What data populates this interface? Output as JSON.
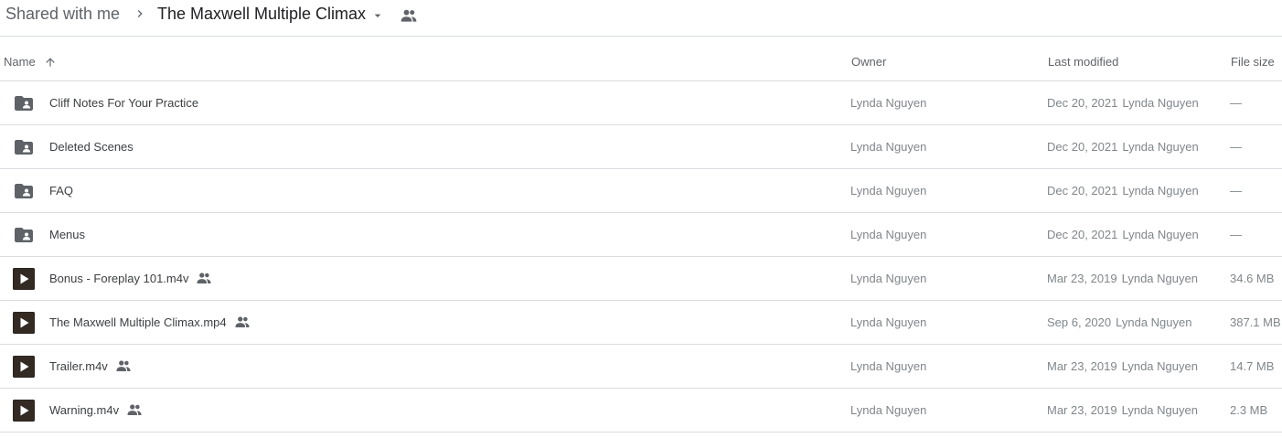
{
  "breadcrumb": {
    "root": "Shared with me",
    "current": "The Maxwell Multiple Climax"
  },
  "columns": {
    "name": "Name",
    "owner": "Owner",
    "last_modified": "Last modified",
    "file_size": "File size"
  },
  "files": [
    {
      "name": "Cliff Notes For Your Practice",
      "type": "shared-folder",
      "owner": "Lynda Nguyen",
      "modified_date": "Dec 20, 2021",
      "modified_by": "Lynda Nguyen",
      "size": "—",
      "shared": false
    },
    {
      "name": "Deleted Scenes",
      "type": "shared-folder",
      "owner": "Lynda Nguyen",
      "modified_date": "Dec 20, 2021",
      "modified_by": "Lynda Nguyen",
      "size": "—",
      "shared": false
    },
    {
      "name": "FAQ",
      "type": "shared-folder",
      "owner": "Lynda Nguyen",
      "modified_date": "Dec 20, 2021",
      "modified_by": "Lynda Nguyen",
      "size": "—",
      "shared": false
    },
    {
      "name": "Menus",
      "type": "shared-folder",
      "owner": "Lynda Nguyen",
      "modified_date": "Dec 20, 2021",
      "modified_by": "Lynda Nguyen",
      "size": "—",
      "shared": false
    },
    {
      "name": "Bonus - Foreplay 101.m4v",
      "type": "video",
      "owner": "Lynda Nguyen",
      "modified_date": "Mar 23, 2019",
      "modified_by": "Lynda Nguyen",
      "size": "34.6 MB",
      "shared": true
    },
    {
      "name": "The Maxwell Multiple Climax.mp4",
      "type": "video",
      "owner": "Lynda Nguyen",
      "modified_date": "Sep 6, 2020",
      "modified_by": "Lynda Nguyen",
      "size": "387.1 MB",
      "shared": true
    },
    {
      "name": "Trailer.m4v",
      "type": "video",
      "owner": "Lynda Nguyen",
      "modified_date": "Mar 23, 2019",
      "modified_by": "Lynda Nguyen",
      "size": "14.7 MB",
      "shared": true
    },
    {
      "name": "Warning.m4v",
      "type": "video",
      "owner": "Lynda Nguyen",
      "modified_date": "Mar 23, 2019",
      "modified_by": "Lynda Nguyen",
      "size": "2.3 MB",
      "shared": true
    }
  ],
  "icons": {
    "breadcrumb_separator": "chevron-right-icon",
    "breadcrumb_dropdown": "caret-down-icon",
    "breadcrumb_shared": "people-icon",
    "sort": "arrow-up-icon",
    "folder": "shared-folder-icon",
    "video": "video-thumbnail-icon",
    "shared": "people-icon"
  },
  "colors": {
    "icon_gray": "#5f6368",
    "divider": "#dadce0",
    "secondary_text": "#80868b"
  }
}
